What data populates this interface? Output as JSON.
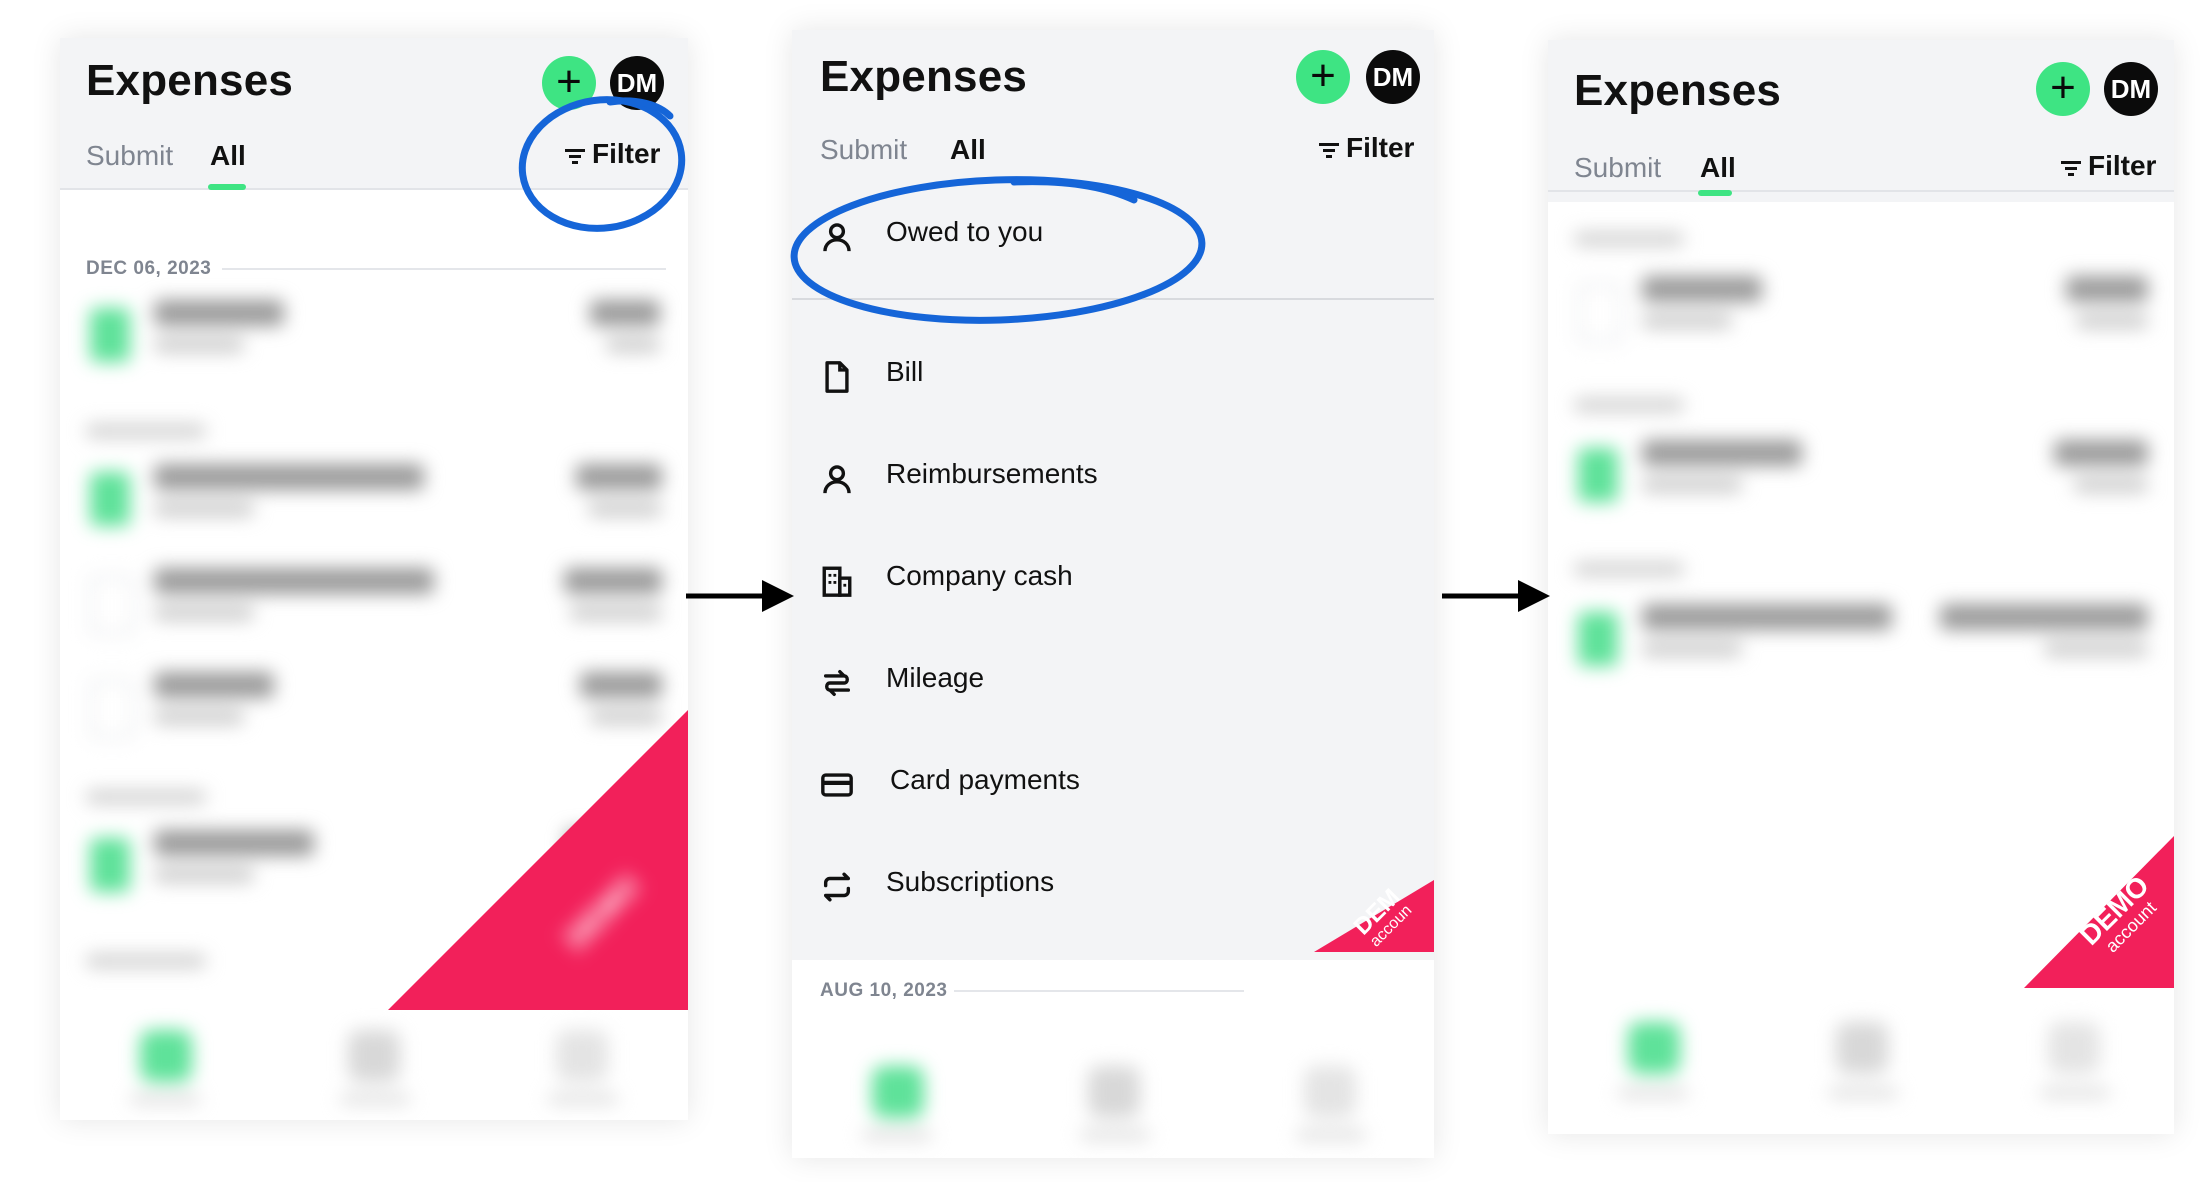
{
  "colors": {
    "accent": "#3ee483",
    "demo_ribbon": "#f2205a",
    "annotation": "#1565d8",
    "arrow": "#000000"
  },
  "app": {
    "title": "Expenses",
    "add_icon": "plus-icon",
    "avatar_initials": "DM",
    "tabs": [
      {
        "label": "Submit"
      },
      {
        "label": "All"
      }
    ],
    "filter_label": "Filter",
    "filter_icon": "filter-lines-icon"
  },
  "panel1": {
    "date_header": "DEC 06, 2023",
    "demo_badge": "DEMO"
  },
  "panel2": {
    "menu_items": [
      {
        "label": "Owed to you",
        "icon": "person-icon"
      },
      {
        "label": "Bill",
        "icon": "document-icon"
      },
      {
        "label": "Reimbursements",
        "icon": "person-icon"
      },
      {
        "label": "Company cash",
        "icon": "building-icon"
      },
      {
        "label": "Mileage",
        "icon": "route-icon"
      },
      {
        "label": "Card payments",
        "icon": "card-icon"
      },
      {
        "label": "Subscriptions",
        "icon": "repeat-icon"
      }
    ],
    "date_header": "AUG 10, 2023",
    "demo_badge_line1": "DEM",
    "demo_badge_line2": "accoun"
  },
  "panel3": {
    "demo_badge_line1": "DEMO",
    "demo_badge_line2": "account"
  }
}
